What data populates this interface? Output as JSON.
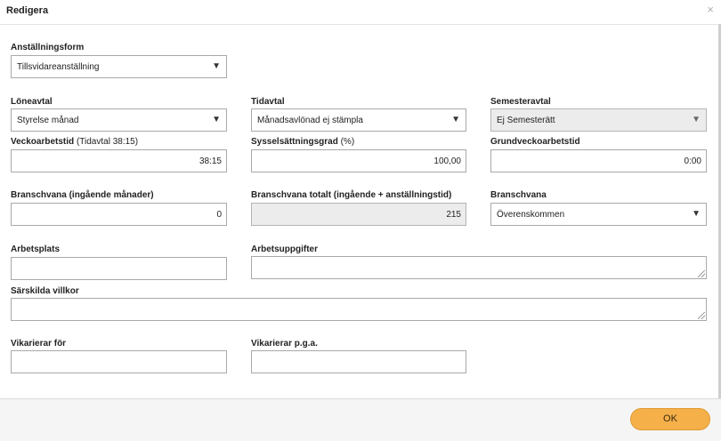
{
  "dialog": {
    "title": "Redigera",
    "close_symbol": "×"
  },
  "fields": {
    "anstallningsform": {
      "label": "Anställningsform",
      "value": "Tillsvidareanställning"
    },
    "loneavtal": {
      "label": "Löneavtal",
      "value": "Styrelse månad"
    },
    "tidavtal": {
      "label": "Tidavtal",
      "value": "Månadsavlönad ej stämpla"
    },
    "semesteravtal": {
      "label": "Semesteravtal",
      "value": "Ej Semesterätt"
    },
    "veckoarbetstid": {
      "label": "Veckoarbetstid",
      "label_note": "(Tidavtal 38:15)",
      "value": "38:15"
    },
    "sysselsattningsgrad": {
      "label": "Sysselsättningsgrad",
      "label_note": "(%)",
      "value": "100,00"
    },
    "grundveckoarbetstid": {
      "label": "Grundveckoarbetstid",
      "value": "0:00"
    },
    "branschvana_ingaende": {
      "label": "Branschvana (ingående månader)",
      "value": "0"
    },
    "branschvana_totalt": {
      "label": "Branschvana totalt (ingående + anställningstid)",
      "value": "215"
    },
    "branschvana": {
      "label": "Branschvana",
      "value": "Överenskommen"
    },
    "arbetsplats": {
      "label": "Arbetsplats",
      "value": ""
    },
    "arbetsuppgifter": {
      "label": "Arbetsuppgifter",
      "value": ""
    },
    "sarskilda_villkor": {
      "label": "Särskilda villkor",
      "value": ""
    },
    "vikarierar_for": {
      "label": "Vikarierar för",
      "value": ""
    },
    "vikarierar_pga": {
      "label": "Vikarierar p.g.a.",
      "value": ""
    }
  },
  "dropdown_caret": "▼",
  "footer": {
    "ok_label": "OK"
  },
  "colors": {
    "ok_button": "#f5b04a",
    "readonly_field": "#ececec"
  }
}
